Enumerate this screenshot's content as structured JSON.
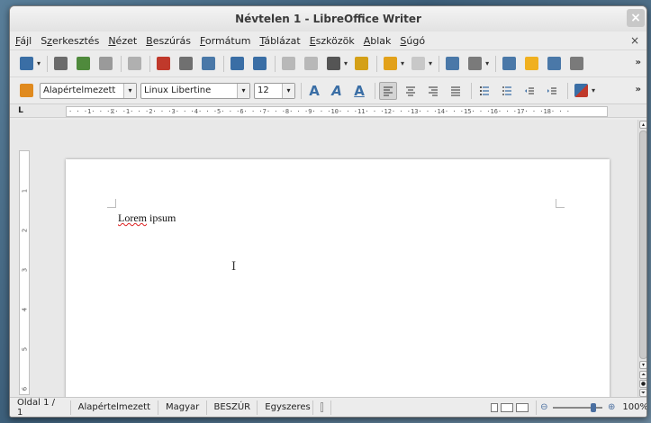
{
  "window": {
    "title": "Névtelen 1 - LibreOffice Writer",
    "close_symbol": "×"
  },
  "menubar": {
    "items": [
      {
        "pre": "",
        "u": "F",
        "post": "ájl"
      },
      {
        "pre": "S",
        "u": "z",
        "post": "erkesztés"
      },
      {
        "pre": "",
        "u": "N",
        "post": "ézet"
      },
      {
        "pre": "",
        "u": "B",
        "post": "eszúrás"
      },
      {
        "pre": "",
        "u": "F",
        "post": "ormátum"
      },
      {
        "pre": "",
        "u": "T",
        "post": "áblázat"
      },
      {
        "pre": "",
        "u": "E",
        "post": "szközök"
      },
      {
        "pre": "",
        "u": "A",
        "post": "blak"
      },
      {
        "pre": "",
        "u": "S",
        "post": "úgó"
      }
    ],
    "doc_close": "×"
  },
  "toolbar1": {
    "icons": [
      {
        "name": "new-document-icon",
        "color": "#3a6ea5"
      },
      {
        "name": "open-folder-icon",
        "color": "#6b6b6b"
      },
      {
        "name": "save-icon",
        "color": "#4f8a3c"
      },
      {
        "name": "email-icon",
        "color": "#9a9a9a"
      },
      {
        "name": "edit-file-icon",
        "color": "#b0b0b0"
      },
      {
        "name": "export-pdf-icon",
        "color": "#c0392b"
      },
      {
        "name": "print-icon",
        "color": "#707070"
      },
      {
        "name": "print-preview-icon",
        "color": "#4a78a8"
      },
      {
        "name": "spellcheck-icon",
        "color": "#3a6ea5"
      },
      {
        "name": "autospellcheck-icon",
        "color": "#3a6ea5"
      },
      {
        "name": "cut-icon",
        "color": "#b8b8b8"
      },
      {
        "name": "copy-icon",
        "color": "#b8b8b8"
      },
      {
        "name": "paste-icon",
        "color": "#555555"
      },
      {
        "name": "clone-formatting-icon",
        "color": "#d4a017"
      },
      {
        "name": "undo-icon",
        "color": "#e2a11a"
      },
      {
        "name": "redo-icon",
        "color": "#c8c8c8"
      },
      {
        "name": "hyperlink-icon",
        "color": "#4a78a8"
      },
      {
        "name": "table-icon",
        "color": "#7a7a7a"
      },
      {
        "name": "draw-functions-icon",
        "color": "#4a78a8"
      },
      {
        "name": "navigator-icon",
        "color": "#f0b020"
      },
      {
        "name": "gallery-icon",
        "color": "#4a78a8"
      },
      {
        "name": "data-sources-icon",
        "color": "#7a7a7a"
      }
    ],
    "more": "»"
  },
  "toolbar2": {
    "styles_icon_color": "#e08a1e",
    "paragraph_style": "Alapértelmezett",
    "font_name": "Linux Libertine",
    "font_size": "12",
    "bold_letter": "A",
    "italic_letter": "A",
    "underline_letter": "A",
    "more": "»"
  },
  "ruler": {
    "corner": "L",
    "horizontal": "· · ·1· · ·⧖· ·1· · ·2· · ·3· · ·4· · ·5· · ·6· · ·7· · ·8· · ·9· · ·10· · ·11· · ·12· · ·13· · ·14· · ·15· · ·16· · ·17· · ·18· · ·",
    "vertical_numbers": [
      "1",
      "2",
      "3",
      "4",
      "5",
      "6"
    ]
  },
  "document": {
    "word1": "Lorem",
    "word2": "ipsum",
    "ibeam": "I"
  },
  "statusbar": {
    "page": "Oldal 1 / 1",
    "style": "Alapértelmezett",
    "language": "Magyar",
    "insert_mode": "BESZÚR",
    "selection_mode": "Egyszeres",
    "zoom_minus": "⊖",
    "zoom_plus": "⊕",
    "zoom": "100%",
    "zoom_level": 0.63
  }
}
